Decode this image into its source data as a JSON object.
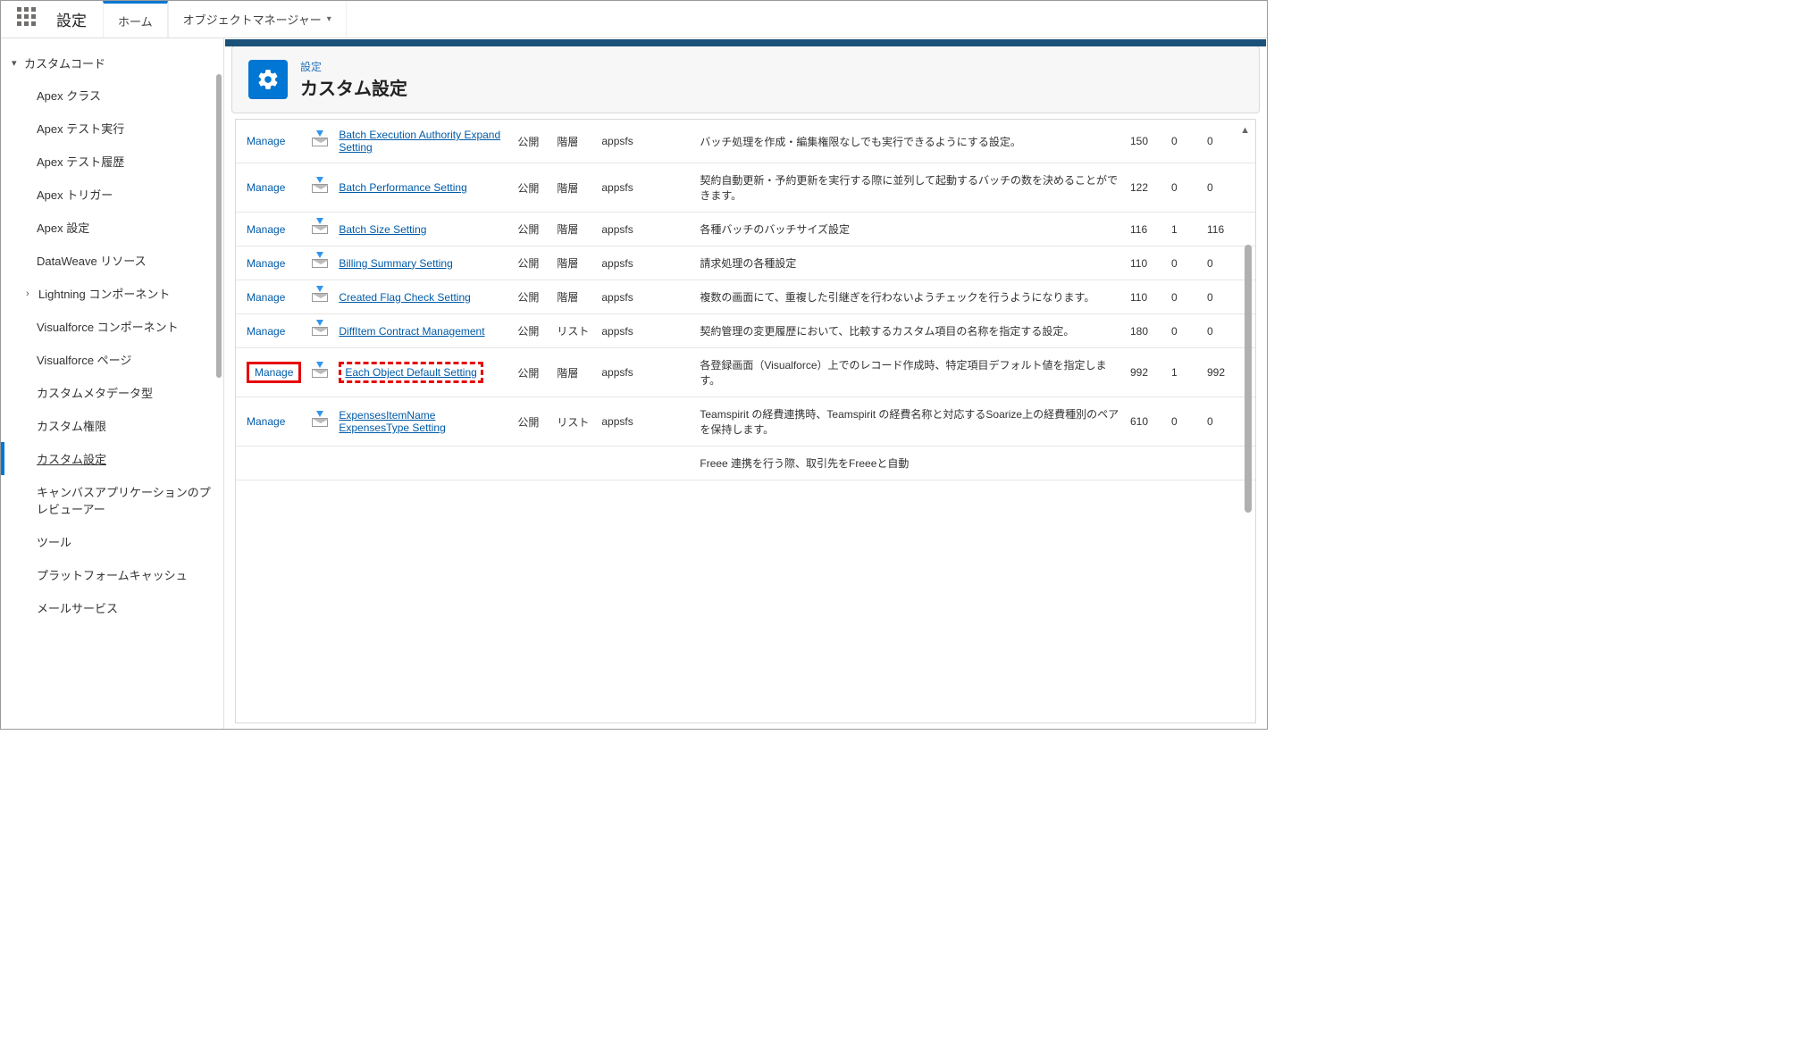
{
  "topbar": {
    "title": "設定",
    "tabs": [
      {
        "label": "ホーム",
        "active": true
      },
      {
        "label": "オブジェクトマネージャー",
        "active": false,
        "dropdown": true
      }
    ]
  },
  "sidebar": {
    "group_label": "カスタムコード",
    "items": [
      {
        "label": "Apex クラス"
      },
      {
        "label": "Apex テスト実行"
      },
      {
        "label": "Apex テスト履歴"
      },
      {
        "label": "Apex トリガー"
      },
      {
        "label": "Apex 設定"
      },
      {
        "label": "DataWeave リソース"
      },
      {
        "label": "Lightning コンポーネント",
        "subgroup": true
      },
      {
        "label": "Visualforce コンポーネント"
      },
      {
        "label": "Visualforce ページ"
      },
      {
        "label": "カスタムメタデータ型"
      },
      {
        "label": "カスタム権限"
      },
      {
        "label": "カスタム設定",
        "active": true
      },
      {
        "label": "キャンバスアプリケーションのプレビューアー"
      },
      {
        "label": "ツール"
      },
      {
        "label": "プラットフォームキャッシュ"
      },
      {
        "label": "メールサービス"
      }
    ]
  },
  "banner": {
    "crumb": "設定",
    "title": "カスタム設定"
  },
  "table": {
    "action_label": "Manage",
    "rows": [
      {
        "name": "Batch Execution Authority Expand Setting",
        "vis": "公開",
        "type": "階層",
        "ns": "appsfs",
        "desc": "バッチ処理を作成・編集権限なしでも実行できるようにする設定。",
        "c1": "150",
        "c2": "0",
        "c3": "0"
      },
      {
        "name": "Batch Performance Setting",
        "vis": "公開",
        "type": "階層",
        "ns": "appsfs",
        "desc": "契約自動更新・予約更新を実行する際に並列して起動するバッチの数を決めることができます。",
        "c1": "122",
        "c2": "0",
        "c3": "0"
      },
      {
        "name": "Batch Size Setting",
        "vis": "公開",
        "type": "階層",
        "ns": "appsfs",
        "desc": "各種バッチのバッチサイズ設定",
        "c1": "116",
        "c2": "1",
        "c3": "116"
      },
      {
        "name": "Billing Summary Setting",
        "vis": "公開",
        "type": "階層",
        "ns": "appsfs",
        "desc": "請求処理の各種設定",
        "c1": "110",
        "c2": "0",
        "c3": "0"
      },
      {
        "name": "Created Flag Check Setting",
        "vis": "公開",
        "type": "階層",
        "ns": "appsfs",
        "desc": "複数の画面にて、重複した引継ぎを行わないようチェックを行うようになります。",
        "c1": "110",
        "c2": "0",
        "c3": "0"
      },
      {
        "name": "DiffItem Contract Management",
        "vis": "公開",
        "type": "リスト",
        "ns": "appsfs",
        "desc": "契約管理の変更履歴において、比較するカスタム項目の名称を指定する設定。",
        "c1": "180",
        "c2": "0",
        "c3": "0"
      },
      {
        "name": "Each Object Default Setting",
        "vis": "公開",
        "type": "階層",
        "ns": "appsfs",
        "desc": "各登録画面（Visualforce）上でのレコード作成時、特定項目デフォルト値を指定します。",
        "c1": "992",
        "c2": "1",
        "c3": "992",
        "highlight": true
      },
      {
        "name": "ExpensesItemName ExpensesType Setting",
        "vis": "公開",
        "type": "リスト",
        "ns": "appsfs",
        "desc": "Teamspirit の経費連携時、Teamspirit の経費名称と対応するSoarize上の経費種別のペアを保持します。",
        "c1": "610",
        "c2": "0",
        "c3": "0"
      },
      {
        "name": "",
        "vis": "",
        "type": "",
        "ns": "",
        "desc": "Freee 連携を行う際、取引先をFreeeと自動",
        "c1": "",
        "c2": "",
        "c3": "",
        "partial": true
      }
    ]
  }
}
